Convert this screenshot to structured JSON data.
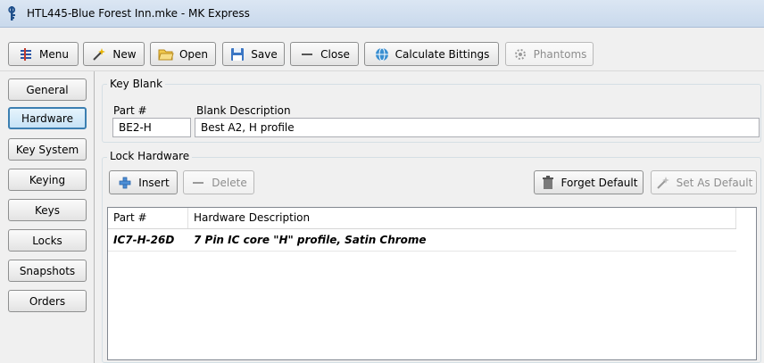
{
  "window": {
    "title": "HTL445-Blue Forest Inn.mke - MK Express"
  },
  "toolbar": {
    "menu": "Menu",
    "new": "New",
    "open": "Open",
    "save": "Save",
    "close": "Close",
    "calculate_bittings": "Calculate Bittings",
    "phantoms": "Phantoms"
  },
  "sidebar": {
    "items": [
      {
        "label": "General"
      },
      {
        "label": "Hardware"
      },
      {
        "label": "Key System"
      },
      {
        "label": "Keying"
      },
      {
        "label": "Keys"
      },
      {
        "label": "Locks"
      },
      {
        "label": "Snapshots"
      },
      {
        "label": "Orders"
      }
    ],
    "active": "Hardware"
  },
  "key_blank": {
    "group_label": "Key Blank",
    "part_label": "Part #",
    "part_value": "BE2-H",
    "desc_label": "Blank Description",
    "desc_value": "Best A2, H profile"
  },
  "lock_hardware": {
    "group_label": "Lock Hardware",
    "insert": "Insert",
    "delete": "Delete",
    "forget_default": "Forget Default",
    "set_as_default": "Set As Default",
    "columns": [
      "Part #",
      "Hardware Description"
    ],
    "rows": [
      {
        "part": "IC7-H-26D",
        "description": "7 Pin IC core \"H\" profile, Satin Chrome"
      }
    ]
  },
  "colors": {
    "accent": "#3c7fb1",
    "title_bar": "#c9d9ec"
  }
}
